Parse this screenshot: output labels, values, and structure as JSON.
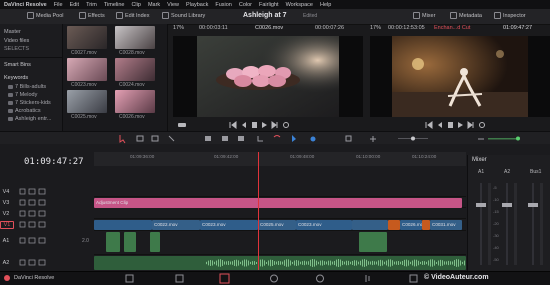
{
  "menubar": {
    "items": [
      "DaVinci Resolve",
      "File",
      "Edit",
      "Trim",
      "Timeline",
      "Clip",
      "Mark",
      "View",
      "Playback",
      "Fusion",
      "Color",
      "Fairlight",
      "Workspace",
      "Help"
    ]
  },
  "toolbar": {
    "media_pool": "Media Pool",
    "effects": "Effects",
    "edit_index": "Edit Index",
    "sound_library": "Sound Library",
    "project_title": "Ashleigh at 7",
    "project_status": "Edited",
    "mixer": "Mixer",
    "metadata": "Metadata",
    "inspector": "Inspector"
  },
  "source_viewer": {
    "zoom": "17%",
    "timecode_left": "00:00:03:11",
    "clip_name": "C0026.mov",
    "timecode_right": "00:00:07:26"
  },
  "program_viewer": {
    "zoom": "17%",
    "timecode_left": "00:00:12:53:05",
    "clip_name": "Enchan...d Cut",
    "timecode_right": "01:09:47:27"
  },
  "left_panel": {
    "master": "Master",
    "video_files": "Video files",
    "selects": "SELECTS",
    "smart_bins": "Smart Bins",
    "keywords": "Keywords",
    "bins": [
      "7 Bills-adults",
      "7 Melody",
      "7 Stickers-kids",
      "Acrobatics",
      "Ashleigh entr..."
    ]
  },
  "thumbnails": {
    "labels": [
      "C0027.mov",
      "C0028.mov",
      "C0023.mov",
      "C0024.mov",
      "C0025.mov",
      "C0026.mov"
    ]
  },
  "timeline": {
    "timecode": "01:09:47:27",
    "ruler": [
      "01:09:36:00",
      "01:09:42:00",
      "01:09:48:00",
      "01:10:00:00",
      "01:10:24:00"
    ],
    "tracks": [
      "V4",
      "V3",
      "V2",
      "V1",
      "A1",
      "A2"
    ],
    "adjustment_clip": "Adjustment Clip",
    "clips_v1": [
      "C0022.mov",
      "C0023.mov",
      "C0025.mov",
      "C0023.mov",
      "C0026.mov",
      "C0031.mov"
    ],
    "audio_channel": "2.0"
  },
  "mixer": {
    "title": "Mixer",
    "channels": [
      "A1",
      "A2",
      "Bus1"
    ],
    "scale": [
      "-5",
      "-10",
      "-15",
      "-20",
      "-30",
      "-40",
      "-50"
    ]
  },
  "bottombar": {
    "app_name": "DaVinci Resolve",
    "watermark": "© VideoAuteur.com"
  },
  "colors": {
    "accent_red": "#e2505a",
    "adjustment_pink": "#d75e93",
    "video_clip": "#2f5d8a",
    "audio_clip": "#3e7a4a",
    "playhead": "#e0343b"
  }
}
